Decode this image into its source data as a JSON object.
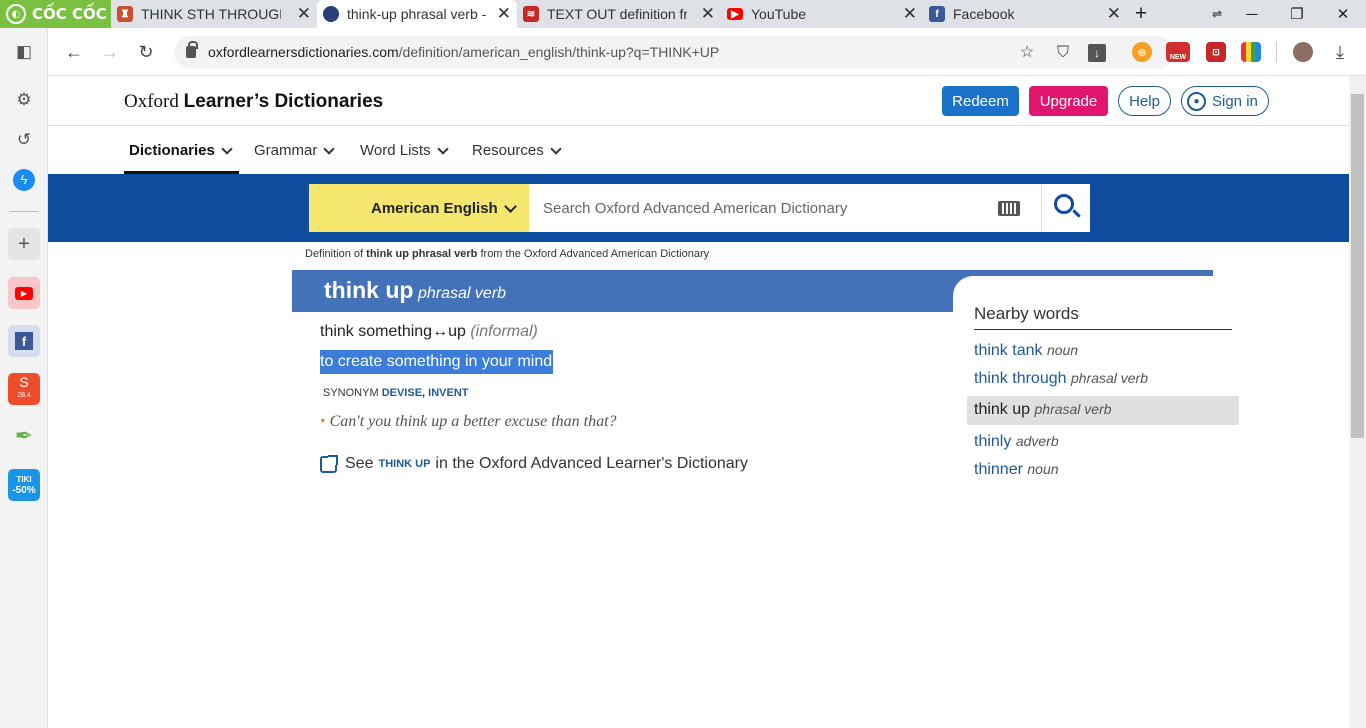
{
  "browser": {
    "logo_text": "CỐC CỐC",
    "tabs": [
      {
        "title": "THINK STH THROUGH |"
      },
      {
        "title": "think-up phrasal verb -"
      },
      {
        "title": "TEXT OUT definition fro"
      },
      {
        "title": "YouTube"
      },
      {
        "title": "Facebook"
      }
    ],
    "url_domain": "oxfordlearnersdictionaries.com",
    "url_path": "/definition/american_english/think-up?q=THINK+UP",
    "ext_new_badge": "NEW"
  },
  "sidebar": {
    "shopee_badge": "28.4",
    "tiki_label": "TIKI",
    "tiki_discount": "-50%"
  },
  "site": {
    "brand_serif": "Oxford",
    "brand_bold": "Learner’s Dictionaries",
    "redeem_label": "Redeem",
    "upgrade_label": "Upgrade",
    "help_label": "Help",
    "signin_label": "Sign in",
    "nav": [
      "Dictionaries",
      "Grammar",
      "Word Lists",
      "Resources"
    ],
    "lang_label": "American English",
    "search_placeholder": "Search Oxford Advanced American Dictionary"
  },
  "entry": {
    "crumb_prefix": "Definition of",
    "crumb_word": "think up phrasal verb",
    "crumb_suffix": "from the Oxford Advanced American Dictionary",
    "headword": "think up",
    "pos": "phrasal verb",
    "sense_phrase": "think something↔up",
    "sense_register": "(informal)",
    "definition": "to create something in your mind",
    "synonym_label": "SYNONYM",
    "synonyms": [
      "DEVISE",
      "INVENT"
    ],
    "example": "Can't you think up a better excuse than that?",
    "see_prefix": "See",
    "see_word": "THINK UP",
    "see_suffix": "in the Oxford Advanced Learner's Dictionary"
  },
  "nearby": {
    "title": "Nearby words",
    "items": [
      {
        "word": "think tank",
        "pos": "noun"
      },
      {
        "word": "think through",
        "pos": "phrasal verb"
      },
      {
        "word": "think up",
        "pos": "phrasal verb"
      },
      {
        "word": "thinly",
        "pos": "adverb"
      },
      {
        "word": "thinner",
        "pos": "noun"
      }
    ]
  },
  "colors": {
    "accent_blue": "#0f4c9d",
    "header_blue": "#4472b8",
    "language_yellow": "#f4e66e",
    "upgrade_pink": "#e0166e",
    "redeem_blue": "#1a73c8",
    "coccoc_green": "#7ac142"
  }
}
